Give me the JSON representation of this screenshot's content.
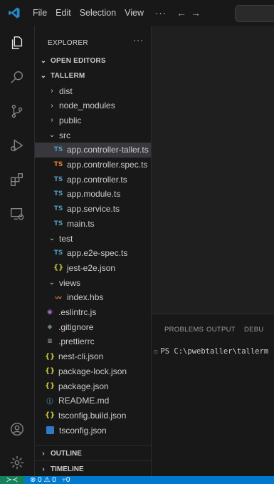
{
  "titlebar": {
    "menus": [
      "File",
      "Edit",
      "Selection",
      "View"
    ],
    "more": "···",
    "back": "←",
    "forward": "→"
  },
  "explorer": {
    "header": "EXPLORER",
    "more": "···",
    "open_editors": "OPEN EDITORS",
    "project": "TALLERM",
    "items": [
      {
        "label": "dist",
        "type": "folder",
        "chevron": "›"
      },
      {
        "label": "node_modules",
        "type": "folder",
        "chevron": "›"
      },
      {
        "label": "public",
        "type": "folder",
        "chevron": "›"
      },
      {
        "label": "src",
        "type": "folder-open",
        "chevron": "⌄"
      },
      {
        "label": "app.controller-taller.ts",
        "type": "ts",
        "selected": true
      },
      {
        "label": "app.controller.spec.ts",
        "type": "ts-test"
      },
      {
        "label": "app.controller.ts",
        "type": "ts"
      },
      {
        "label": "app.module.ts",
        "type": "ts"
      },
      {
        "label": "app.service.ts",
        "type": "ts"
      },
      {
        "label": "main.ts",
        "type": "ts"
      },
      {
        "label": "test",
        "type": "folder-open",
        "chevron": "⌄"
      },
      {
        "label": "app.e2e-spec.ts",
        "type": "ts"
      },
      {
        "label": "jest-e2e.json",
        "type": "json"
      },
      {
        "label": "views",
        "type": "folder-open",
        "chevron": "⌄"
      },
      {
        "label": "index.hbs",
        "type": "hbs"
      },
      {
        "label": ".eslintrc.js",
        "type": "eslint"
      },
      {
        "label": ".gitignore",
        "type": "git"
      },
      {
        "label": ".prettierrc",
        "type": "prettier"
      },
      {
        "label": "nest-cli.json",
        "type": "json"
      },
      {
        "label": "package-lock.json",
        "type": "json"
      },
      {
        "label": "package.json",
        "type": "json"
      },
      {
        "label": "README.md",
        "type": "info"
      },
      {
        "label": "tsconfig.build.json",
        "type": "json"
      },
      {
        "label": "tsconfig.json",
        "type": "tsconfig"
      }
    ],
    "outline": "OUTLINE",
    "timeline": "TIMELINE"
  },
  "icons": {
    "ts": "TS",
    "json": "{}",
    "hbs": "〰",
    "eslint": "◉",
    "git": "◆",
    "prettier": "≡",
    "info": "ⓘ"
  },
  "panel": {
    "tabs": [
      "PROBLEMS",
      "OUTPUT",
      "DEBU"
    ],
    "terminal_line": "PS C:\\pwebtaller\\tallerm"
  },
  "statusbar": {
    "remote": "≻≺",
    "problems": "⊗ 0 ⚠ 0",
    "ports": "⑂0"
  },
  "colors": {
    "accent": "#007acc",
    "remote": "#16825d",
    "ts": "#519aba",
    "json": "#cbcb41"
  }
}
